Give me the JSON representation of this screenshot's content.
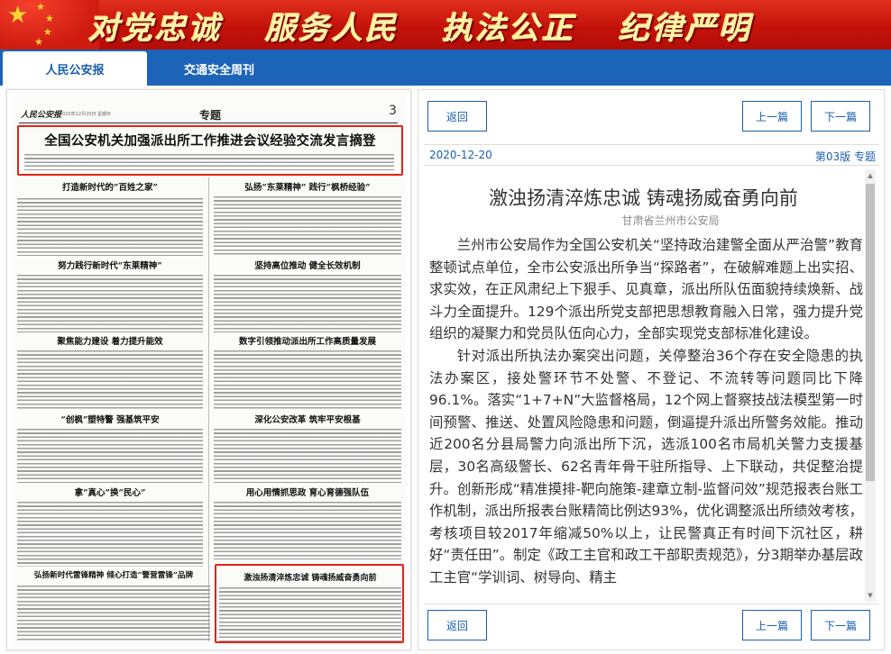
{
  "banner": {
    "slogans": [
      "对党忠诚",
      "服务人民",
      "执法公正",
      "纪律严明"
    ],
    "colors": {
      "red": "#c4120a",
      "gold": "#ffd633",
      "slogan_text": "#fff3a6"
    }
  },
  "tabs": [
    {
      "label": "人民公安报",
      "active": true
    },
    {
      "label": "交通安全周刊",
      "active": false
    }
  ],
  "paper": {
    "page_number": "3",
    "section": "专题",
    "masthead": "人民公安报",
    "date_line": "2020年12月20日 星期日",
    "main_title": "全国公安机关加强派出所工作推进会议经验交流发言摘登",
    "article_headlines": [
      "打造新时代的“百姓之家”",
      "弘扬“东莱精神” 践行“枫桥经验”",
      "努力践行新时代“东莱精神”",
      "坚持高位推动 健全长效机制",
      "聚焦能力建设 着力提升能效",
      "数字引领推动派出所工作高质量发展",
      "“创枫”塑特警 强基筑平安",
      "深化公安改革 筑牢平安根基",
      "拿“真心”换“民心”",
      "用心用情抓思政 育心育德强队伍",
      "弘扬新时代雷锋精神 倾心打造“警营雷锋”品牌",
      "激浊扬清淬炼忠诚 铸魂扬威奋勇向前"
    ]
  },
  "article": {
    "nav": {
      "back": "返回",
      "prev": "上一篇",
      "next": "下一篇"
    },
    "date": "2020-12-20",
    "page_info": "第03版 专题",
    "title": "激浊扬清淬炼忠诚 铸魂扬威奋勇向前",
    "author": "甘肃省兰州市公安局",
    "paragraphs": [
      "兰州市公安局作为全国公安机关“坚持政治建警全面从严治警”教育整顿试点单位，全市公安派出所争当“探路者”，在破解难题上出实招、求实效，在正风肃纪上下狠手、见真章，派出所队伍面貌持续焕新、战斗力全面提升。129个派出所党支部把思想教育融入日常，强力提升党组织的凝聚力和党员队伍向心力，全部实现党支部标准化建设。",
      "针对派出所执法办案突出问题，关停整治36个存在安全隐患的执法办案区，接处警环节不处警、不登记、不流转等问题同比下降96.1%。落实“1+7+N”大监督格局，12个网上督察技战法模型第一时间预警、推送、处置风险隐患和问题，倒逼提升派出所警务效能。推动近200名分县局警力向派出所下沉，选派100名市局机关警力支援基层，30名高级警长、62名青年骨干驻所指导、上下联动，共促整治提升。创新形成“精准摸排-靶向施策-建章立制-监督问效”规范报表台账工作机制，派出所报表台账精简比例达93%，优化调整派出所绩效考核，考核项目较2017年缩减50%以上，让民警真正有时间下沉社区，耕好“责任田”。制定《政工主官和政工干部职责规范》，分3期举办基层政工主官“学训词、树导向、精主"
    ]
  }
}
